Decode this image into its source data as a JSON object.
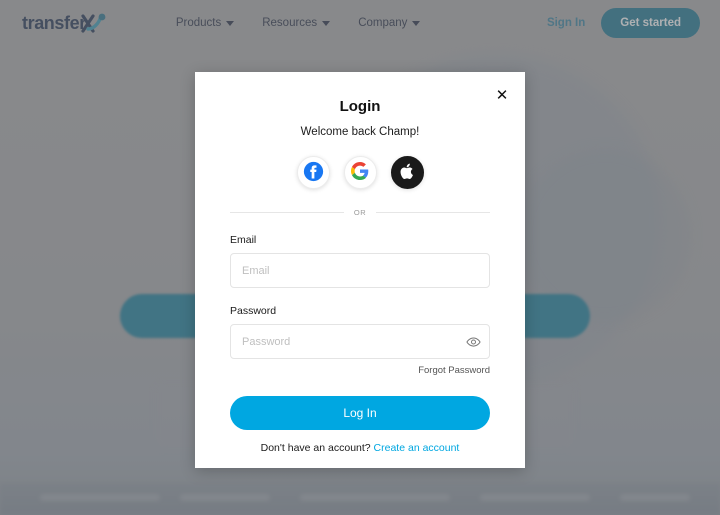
{
  "navbar": {
    "logo_text": "transfer",
    "logo_mark": "x-swoosh-icon",
    "links": [
      {
        "label": "Products",
        "icon": "chevron-down-icon"
      },
      {
        "label": "Resources",
        "icon": "chevron-down-icon"
      },
      {
        "label": "Company",
        "icon": "chevron-down-icon"
      }
    ],
    "signin_label": "Sign In",
    "get_started_label": "Get started"
  },
  "modal": {
    "title": "Login",
    "subtitle": "Welcome back Champ!",
    "close_label": "✕",
    "social": [
      {
        "name": "facebook",
        "icon": "facebook-icon"
      },
      {
        "name": "google",
        "icon": "google-icon"
      },
      {
        "name": "apple",
        "icon": "apple-icon"
      }
    ],
    "divider_text": "OR",
    "email": {
      "label": "Email",
      "placeholder": "Email",
      "value": ""
    },
    "password": {
      "label": "Password",
      "placeholder": "Password",
      "value": "",
      "toggle_icon": "eye-icon",
      "forgot_label": "Forgot Password"
    },
    "submit_label": "Log In",
    "signup_prompt": "Don't have an account?",
    "signup_link_label": "Create an account"
  },
  "colors": {
    "brand_navy": "#15284b",
    "brand_teal": "#10718f",
    "accent_cyan": "#00a7e1",
    "signin_teal": "#2d7f9e",
    "overlay": "rgba(110,112,115,0.55)"
  }
}
